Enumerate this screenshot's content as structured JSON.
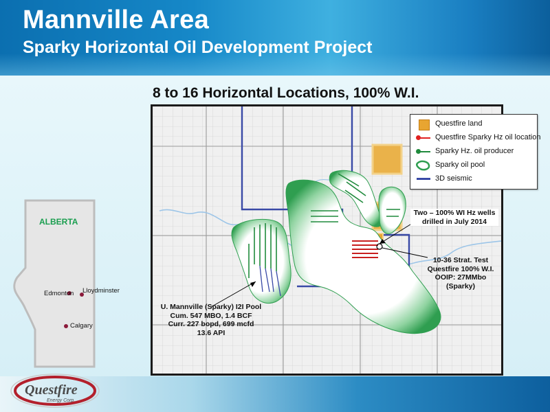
{
  "header": {
    "title": "Mannville Area",
    "subtitle": "Sparky Horizontal Oil Development Project"
  },
  "map": {
    "title": "8 to 16  Horizontal Locations, 100% W.I.",
    "legend": [
      {
        "icon": "questfire-land-swatch",
        "label": "Questfire land"
      },
      {
        "icon": "hz-location-symbol",
        "label": "Questfire Sparky Hz oil location"
      },
      {
        "icon": "hz-producer-symbol",
        "label": "Sparky Hz. oil producer"
      },
      {
        "icon": "oil-pool-symbol",
        "label": "Sparky oil pool"
      },
      {
        "icon": "seismic-line-symbol",
        "label": "3D seismic"
      }
    ],
    "annotations": {
      "wells_line1": "Two – 100% WI Hz wells",
      "wells_line2": "drilled in July 2014",
      "strat_line1": "10-36 Strat. Test",
      "strat_line2": "Questfire 100% W.I.",
      "strat_line3": "OOIP: 27MMbo",
      "strat_line4": "(Sparky)",
      "pool_line1": "U. Mannville (Sparky) I2I Pool",
      "pool_line2": "Cum. 547 MBO, 1.4 BCF",
      "pool_line3": "Curr. 227 bopd, 699 mcfd",
      "pool_line4": "13.6 API"
    },
    "colors": {
      "land": "#e8a531",
      "pool": "#3aa357",
      "seismic": "#3949a6",
      "hz_location": "#e02020",
      "producer": "#1f8a3c"
    }
  },
  "inset": {
    "province": "ALBERTA",
    "cities": [
      "Edmonton",
      "Lloydminster",
      "Calgary"
    ]
  },
  "footer": {
    "logo_name": "Questfire",
    "logo_sub": "Energy Corp."
  }
}
